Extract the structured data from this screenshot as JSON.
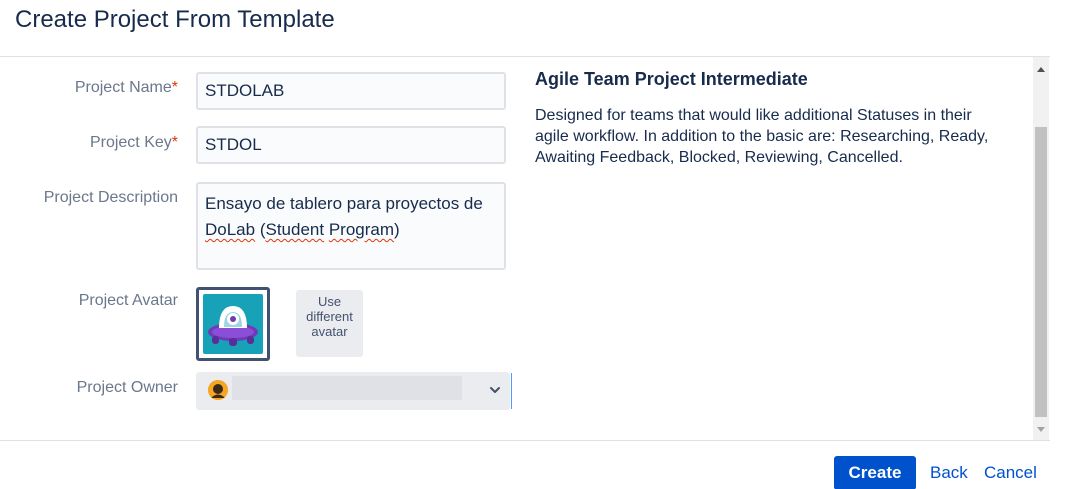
{
  "dialog": {
    "title": "Create Project From Template"
  },
  "form": {
    "project_name": {
      "label": "Project Name",
      "required_mark": "*",
      "value": "STDOLAB"
    },
    "project_key": {
      "label": "Project Key",
      "required_mark": "*",
      "value": "STDOL"
    },
    "project_description": {
      "label": "Project Description",
      "value_part1": "Ensayo de tablero para proyectos de ",
      "value_word1": "DoLab",
      "value_part2": " (",
      "value_word2": "Student",
      "value_part3": " ",
      "value_word3": "Program",
      "value_part4": ")"
    },
    "project_avatar": {
      "label": "Project Avatar",
      "use_different_label": "Use different avatar"
    },
    "project_owner": {
      "label": "Project Owner"
    }
  },
  "template_info": {
    "title": "Agile Team Project Intermediate",
    "description": "Designed for teams that would like additional Statuses in their agile workflow. In addition to the basic are: Researching, Ready, Awaiting Feedback, Blocked, Reviewing, Cancelled."
  },
  "footer": {
    "create_label": "Create",
    "back_label": "Back",
    "cancel_label": "Cancel"
  },
  "colors": {
    "primary": "#0052cc",
    "required": "#de350b",
    "avatar_bg": "#17a2b8"
  },
  "icons": {
    "avatar": "purple-robot-avatar-icon",
    "owner": "user-avatar-icon",
    "dropdown": "chevron-down-icon"
  }
}
